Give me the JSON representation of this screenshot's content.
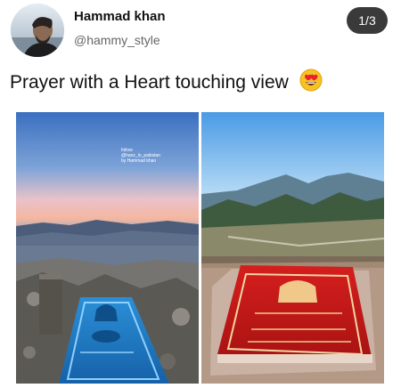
{
  "author": {
    "name": "Hammad khan",
    "handle": "@hammy_style",
    "avatar_icon": "profile-photo"
  },
  "pager": {
    "label": "1/3"
  },
  "post": {
    "text": "Prayer with a Heart touching view",
    "emoji_icon": "heart-eyes-emoji"
  },
  "images": [
    {
      "watermark_line1": "follow",
      "watermark_line2": "@hanz_lo_pakistan",
      "watermark_line3": "by Hammad khan"
    },
    {}
  ],
  "colors": {
    "pager_bg": "#3a3a3a",
    "handle_gray": "#666666",
    "rug_blue": "#1b7bc4",
    "rug_red": "#c21a1a"
  }
}
